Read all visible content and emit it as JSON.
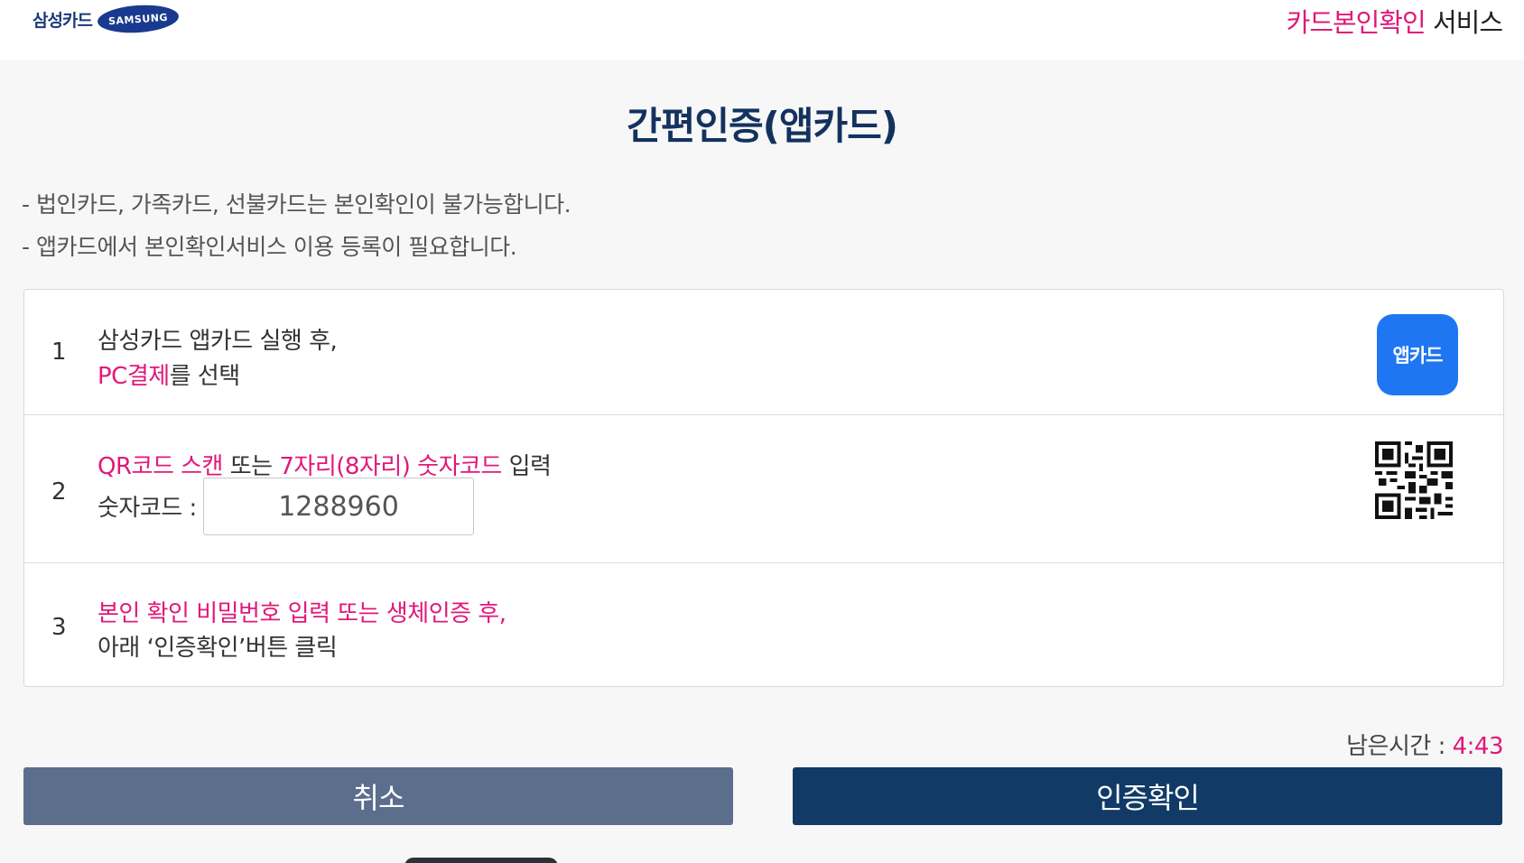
{
  "header": {
    "logo_text": "삼성카드",
    "logo_brand": "SAMSUNG",
    "service_title_highlight": "카드본인확인",
    "service_title_rest": " 서비스"
  },
  "title": "간편인증(앱카드)",
  "notices": [
    "- 법인카드, 가족카드, 선불카드는 본인확인이 불가능합니다.",
    "- 앱카드에서 본인확인서비스 이용 등록이 필요합니다."
  ],
  "steps": [
    {
      "number": "1",
      "line1": "삼성카드 앱카드 실행 후,",
      "line2_highlight": "PC결제",
      "line2_rest": "를 선택",
      "icon": "앱카드"
    },
    {
      "number": "2",
      "line1_highlight_a": "QR코드 스캔",
      "line1_mid": " 또는 ",
      "line1_highlight_b": "7자리(8자리) 숫자코드",
      "line1_rest": " 입력",
      "code_label": "숫자코드 :",
      "code_value": "1288960",
      "icon": "qr-code-icon"
    },
    {
      "number": "3",
      "line1": "본인 확인 비밀번호 입력 또는 생체인증 후,",
      "line2": "아래 ‘인증확인’버튼 클릭"
    }
  ],
  "timer": {
    "label": "남은시간 : ",
    "value": "4:43"
  },
  "buttons": {
    "cancel": "취소",
    "confirm": "인증확인"
  },
  "colors": {
    "accent_pink": "#e0187a",
    "title_navy": "#13325e",
    "cancel_bg": "#5b6e8c",
    "confirm_bg": "#113a66",
    "appcard_blue": "#1f76f2"
  }
}
